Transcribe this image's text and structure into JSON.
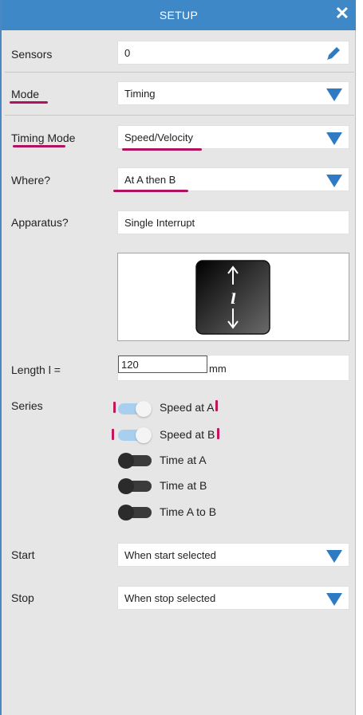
{
  "title": "SETUP",
  "close_glyph": "✕",
  "sensors": {
    "label": "Sensors",
    "value": "0",
    "edit_icon": "pencil-icon"
  },
  "mode": {
    "label": "Mode",
    "value": "Timing"
  },
  "timing_mode": {
    "label": "Timing Mode",
    "value": "Speed/Velocity"
  },
  "where": {
    "label": "Where?",
    "value": "At A then B"
  },
  "apparatus": {
    "label": "Apparatus?",
    "value": "Single Interrupt",
    "image_icon": "single-interrupt-card-icon",
    "card_letter": "l"
  },
  "length": {
    "label": "Length l =",
    "value": "120",
    "unit": "mm"
  },
  "series": {
    "label": "Series",
    "items": [
      {
        "label": "Speed at A",
        "on": true
      },
      {
        "label": "Speed at B",
        "on": true
      },
      {
        "label": "Time at A",
        "on": false
      },
      {
        "label": "Time at B",
        "on": false
      },
      {
        "label": "Time A to B",
        "on": false
      }
    ]
  },
  "start": {
    "label": "Start",
    "value": "When start selected"
  },
  "stop": {
    "label": "Stop",
    "value": "When stop selected"
  },
  "colors": {
    "header": "#3f88c8",
    "dropdown_arrow": "#2f7bc3",
    "annotation": "#b0125f",
    "toggle_on": "#a9cfee",
    "toggle_off": "#3b3b3b",
    "selected_border": "#e8953c"
  }
}
